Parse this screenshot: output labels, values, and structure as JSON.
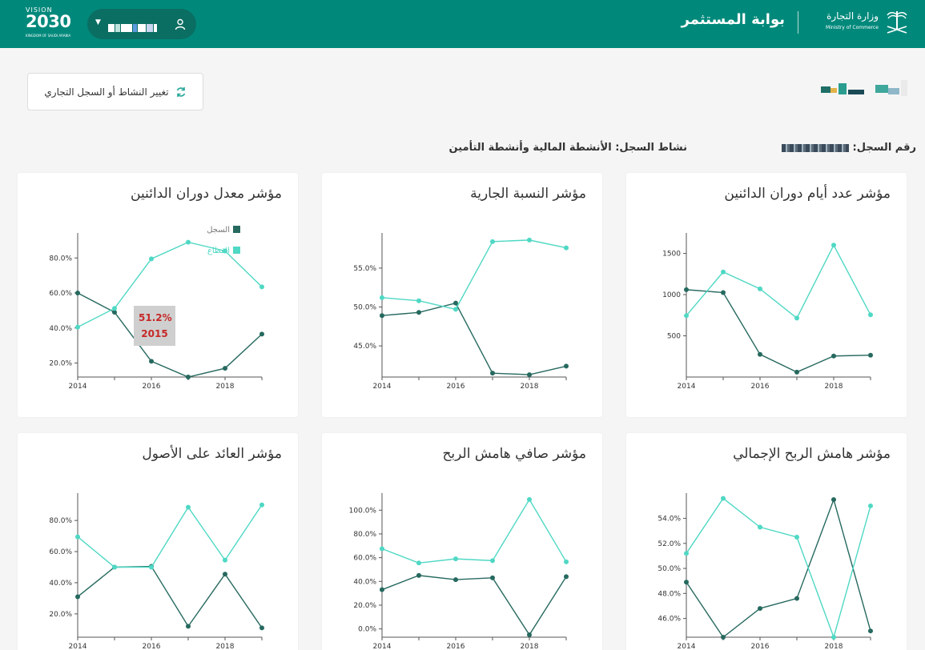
{
  "header": {
    "vision": {
      "line1": "VISION",
      "year": "2030",
      "sub": "KINGDOM OF SAUDI ARABIA"
    },
    "portal_title": "بوابة المستثمر",
    "ministry_ar": "وزارة التجارة",
    "ministry_en": "Ministry of Commerce",
    "user_icon": "user-icon",
    "dropdown_icon": "caret-down-icon"
  },
  "toolbar": {
    "change_label": "تغيير النشاط أو السجل التجاري",
    "change_icon": "refresh-icon"
  },
  "info": {
    "reg_label": "رقم السجل:",
    "activity_label": "نشاط السجل:",
    "activity_value": "الأنشطة المالية وأنشطة التأمين"
  },
  "colors": {
    "teal_header": "#00897b",
    "record": "#26695f",
    "sector": "#4fd8c4",
    "tooltip_text": "#c62828"
  },
  "legend": {
    "record": "السجل",
    "sector": "القطاع"
  },
  "tooltip": {
    "value": "51.2%",
    "year": "2015"
  },
  "charts": [
    {
      "title": "مؤشر معدل دوران الدائنين"
    },
    {
      "title": "مؤشر النسبة الجارية"
    },
    {
      "title": "مؤشر عدد أيام دوران الدائنين"
    },
    {
      "title": "مؤشر العائد على الأصول"
    },
    {
      "title": "مؤشر صافي هامش الربح"
    },
    {
      "title": "مؤشر هامش الربح الإجمالي"
    }
  ],
  "chart_data": [
    {
      "type": "line",
      "title": "مؤشر معدل دوران الدائنين",
      "x": [
        2014,
        2015,
        2016,
        2017,
        2018,
        2019
      ],
      "xticks": [
        "2014",
        "2016",
        "2018"
      ],
      "yticks": [
        "20.0%",
        "40.0%",
        "60.0%",
        "80.0%"
      ],
      "series": [
        {
          "name": "السجل",
          "values": [
            60.0,
            49.0,
            21.0,
            12.0,
            17.0,
            36.5
          ]
        },
        {
          "name": "القطاع",
          "values": [
            40.5,
            51.2,
            79.5,
            89.0,
            84.0,
            63.5
          ]
        }
      ],
      "legend": "top-right"
    },
    {
      "type": "line",
      "title": "مؤشر النسبة الجارية",
      "x": [
        2014,
        2015,
        2016,
        2017,
        2018,
        2019
      ],
      "xticks": [
        "2014",
        "2016",
        "2018"
      ],
      "yticks": [
        "45.0%",
        "50.0%",
        "55.0%"
      ],
      "series": [
        {
          "name": "السجل",
          "values": [
            48.9,
            49.3,
            50.5,
            41.5,
            41.3,
            42.4
          ]
        },
        {
          "name": "القطاع",
          "values": [
            51.2,
            50.8,
            49.7,
            58.4,
            58.6,
            57.6
          ]
        }
      ]
    },
    {
      "type": "line",
      "title": "مؤشر عدد أيام دوران الدائنين",
      "x": [
        2014,
        2015,
        2016,
        2017,
        2018,
        2019
      ],
      "xticks": [
        "2014",
        "2016",
        "2018"
      ],
      "yticks": [
        "500",
        "1000",
        "1500"
      ],
      "series": [
        {
          "name": "السجل",
          "values": [
            1060,
            1025,
            275,
            60,
            255,
            265
          ]
        },
        {
          "name": "القطاع",
          "values": [
            745,
            1275,
            1070,
            715,
            1600,
            755
          ]
        }
      ]
    },
    {
      "type": "line",
      "title": "مؤشر العائد على الأصول",
      "x": [
        2014,
        2015,
        2016,
        2017,
        2018,
        2019
      ],
      "xticks": [
        "2014",
        "2016",
        "2018"
      ],
      "yticks": [
        "20.0%",
        "40.0%",
        "60.0%",
        "80.0%"
      ],
      "series": [
        {
          "name": "السجل",
          "values": [
            31.0,
            50.0,
            50.5,
            12.0,
            45.5,
            11.0
          ]
        },
        {
          "name": "القطاع",
          "values": [
            69.5,
            50.0,
            50.0,
            88.5,
            54.5,
            90.0
          ]
        }
      ]
    },
    {
      "type": "line",
      "title": "مؤشر صافي هامش الربح",
      "x": [
        2014,
        2015,
        2016,
        2017,
        2018,
        2019
      ],
      "xticks": [
        "2014",
        "2016",
        "2018"
      ],
      "yticks": [
        "0.0%",
        "20.0%",
        "40.0%",
        "60.0%",
        "80.0%",
        "100.0%"
      ],
      "series": [
        {
          "name": "السجل",
          "values": [
            33.0,
            45.0,
            41.5,
            43.0,
            -5.0,
            44.0
          ]
        },
        {
          "name": "القطاع",
          "values": [
            67.5,
            55.5,
            59.0,
            57.5,
            109.0,
            56.5
          ]
        }
      ]
    },
    {
      "type": "line",
      "title": "مؤشر هامش الربح الإجمالي",
      "x": [
        2014,
        2015,
        2016,
        2017,
        2018,
        2019
      ],
      "xticks": [
        "2014",
        "2016",
        "2018"
      ],
      "yticks": [
        "46.0%",
        "48.0%",
        "50.0%",
        "52.0%",
        "54.0%"
      ],
      "series": [
        {
          "name": "السجل",
          "values": [
            48.9,
            44.5,
            46.8,
            47.6,
            55.5,
            45.0
          ]
        },
        {
          "name": "القطاع",
          "values": [
            51.2,
            55.6,
            53.3,
            52.5,
            44.5,
            55.0
          ]
        }
      ]
    }
  ]
}
